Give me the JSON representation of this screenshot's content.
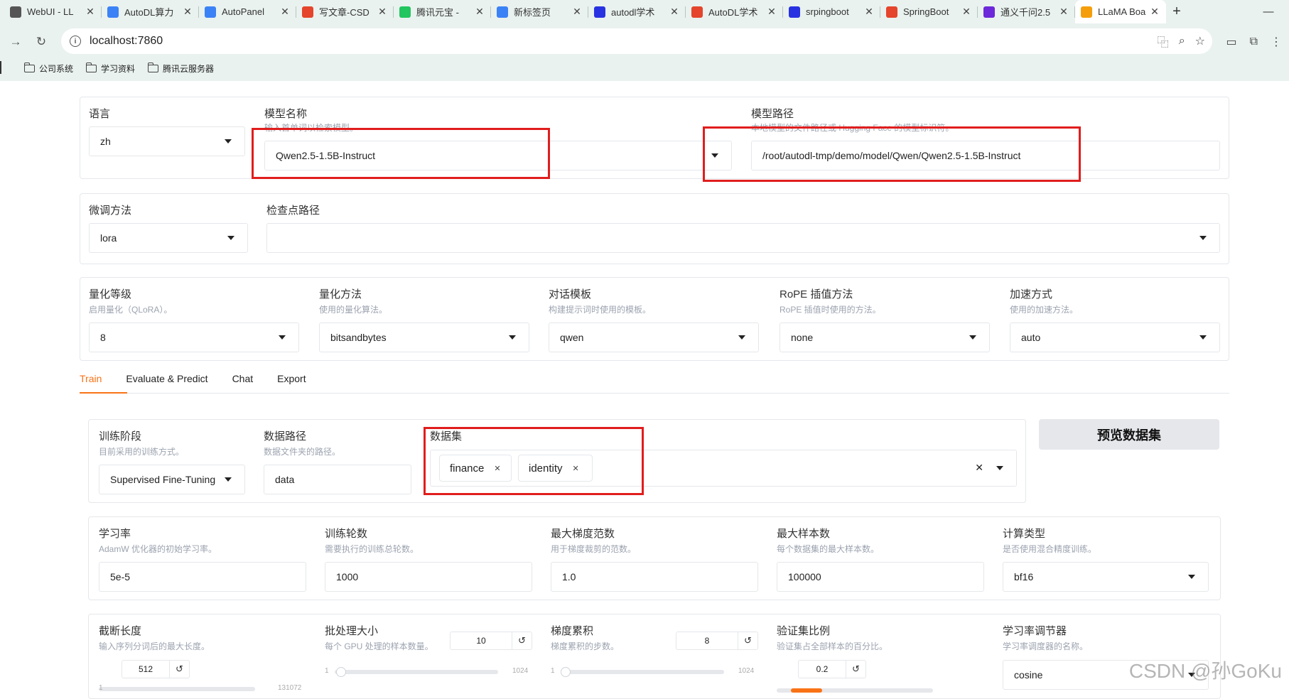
{
  "browser": {
    "tabs": [
      {
        "title": "WebUI - LL",
        "fav": "#555"
      },
      {
        "title": "AutoDL算力",
        "fav": "#3b82f6"
      },
      {
        "title": "AutoPanel",
        "fav": "#3b82f6"
      },
      {
        "title": "写文章-CSD",
        "fav": "#e4452c"
      },
      {
        "title": "腾讯元宝 -",
        "fav": "#22c55e"
      },
      {
        "title": "新标签页",
        "fav": "#3b82f6"
      },
      {
        "title": "autodl学术",
        "fav": "#2932e1"
      },
      {
        "title": "AutoDL学术",
        "fav": "#e4452c"
      },
      {
        "title": "srpingboot",
        "fav": "#2932e1"
      },
      {
        "title": "SpringBoot",
        "fav": "#e4452c"
      },
      {
        "title": "通义千问2.5",
        "fav": "#6d28d9"
      },
      {
        "title": "LLaMA Boa",
        "fav": "#f59e0b"
      }
    ],
    "url": "localhost:7860",
    "bookmarks": [
      "公司系统",
      "学习资料",
      "腾讯云服务器"
    ]
  },
  "top": {
    "lang_label": "语言",
    "lang_value": "zh",
    "model_label": "模型名称",
    "model_desc": "输入首单词以检索模型。",
    "model_value": "Qwen2.5-1.5B-Instruct",
    "path_label": "模型路径",
    "path_desc": "本地模型的文件路径或 Hugging Face 的模型标识符。",
    "path_value": "/root/autodl-tmp/demo/model/Qwen/Qwen2.5-1.5B-Instruct"
  },
  "ft": {
    "method_label": "微调方法",
    "method_value": "lora",
    "ckpt_label": "检查点路径"
  },
  "quant": {
    "fields": [
      {
        "label": "量化等级",
        "desc": "启用量化（QLoRA）。",
        "value": "8"
      },
      {
        "label": "量化方法",
        "desc": "使用的量化算法。",
        "value": "bitsandbytes"
      },
      {
        "label": "对话模板",
        "desc": "构建提示词时使用的模板。",
        "value": "qwen"
      },
      {
        "label": "RoPE 插值方法",
        "desc": "RoPE 插值时使用的方法。",
        "value": "none"
      },
      {
        "label": "加速方式",
        "desc": "使用的加速方法。",
        "value": "auto"
      }
    ]
  },
  "tabs": [
    "Train",
    "Evaluate & Predict",
    "Chat",
    "Export"
  ],
  "train": {
    "stage_label": "训练阶段",
    "stage_desc": "目前采用的训练方式。",
    "stage_value": "Supervised Fine-Tuning",
    "dir_label": "数据路径",
    "dir_desc": "数据文件夹的路径。",
    "dir_value": "data",
    "ds_label": "数据集",
    "ds_items": [
      "finance",
      "identity"
    ],
    "preview_btn": "预览数据集",
    "row1": [
      {
        "label": "学习率",
        "desc": "AdamW 优化器的初始学习率。",
        "value": "5e-5"
      },
      {
        "label": "训练轮数",
        "desc": "需要执行的训练总轮数。",
        "value": "1000"
      },
      {
        "label": "最大梯度范数",
        "desc": "用于梯度裁剪的范数。",
        "value": "1.0"
      },
      {
        "label": "最大样本数",
        "desc": "每个数据集的最大样本数。",
        "value": "100000"
      },
      {
        "label": "计算类型",
        "desc": "是否使用混合精度训练。",
        "value": "bf16"
      }
    ],
    "row2": {
      "cutoff_label": "截断长度",
      "cutoff_desc": "输入序列分词后的最大长度。",
      "cutoff_value": "512",
      "cutoff_min": "1",
      "cutoff_max": "131072",
      "batch_label": "批处理大小",
      "batch_desc": "每个 GPU 处理的样本数量。",
      "batch_value": "10",
      "batch_min": "1",
      "batch_max": "1024",
      "accum_label": "梯度累积",
      "accum_desc": "梯度累积的步数。",
      "accum_value": "8",
      "accum_min": "1",
      "accum_max": "1024",
      "val_label": "验证集比例",
      "val_desc": "验证集占全部样本的百分比。",
      "val_value": "0.2",
      "sched_label": "学习率调节器",
      "sched_desc": "学习率调度器的名称。",
      "sched_value": "cosine"
    }
  },
  "watermark": "CSDN @孙GoKu"
}
